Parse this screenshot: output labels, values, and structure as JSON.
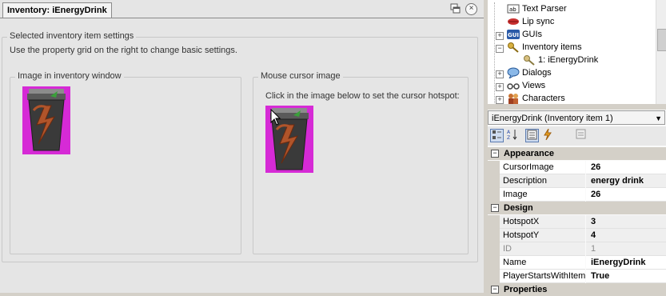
{
  "document": {
    "tab_title": "Inventory: iEnergyDrink",
    "close_glyph": "×"
  },
  "settings": {
    "group_title": "Selected inventory item settings",
    "description": "Use the property grid on the right to change basic settings.",
    "inventory_image_title": "Image in inventory window",
    "cursor_image_title": "Mouse cursor image",
    "cursor_hint": "Click in the image below to set the cursor hotspot:"
  },
  "tree": {
    "items": [
      {
        "label": "Text Parser",
        "icon": "text-parser-icon"
      },
      {
        "label": "Lip sync",
        "icon": "lips-icon"
      },
      {
        "label": "GUIs",
        "icon": "gui-icon"
      },
      {
        "label": "Inventory items",
        "icon": "key-icon"
      },
      {
        "label": "1: iEnergyDrink",
        "icon": "key-icon"
      },
      {
        "label": "Dialogs",
        "icon": "speech-bubble-icon"
      },
      {
        "label": "Views",
        "icon": "glasses-icon"
      },
      {
        "label": "Characters",
        "icon": "characters-icon"
      }
    ]
  },
  "property_grid": {
    "selected_object": "iEnergyDrink (Inventory item 1)",
    "categories": [
      {
        "name": "Appearance",
        "properties": [
          {
            "name": "CursorImage",
            "value": "26"
          },
          {
            "name": "Description",
            "value": "energy drink"
          },
          {
            "name": "Image",
            "value": "26"
          }
        ]
      },
      {
        "name": "Design",
        "properties": [
          {
            "name": "HotspotX",
            "value": "3"
          },
          {
            "name": "HotspotY",
            "value": "4"
          },
          {
            "name": "ID",
            "value": "1"
          },
          {
            "name": "Name",
            "value": "iEnergyDrink"
          },
          {
            "name": "PlayerStartsWithItem",
            "value": "True"
          }
        ]
      },
      {
        "name": "Properties",
        "properties": []
      }
    ]
  },
  "colors": {
    "sprite_background": "#d62ad6",
    "cup_body": "#3a3a3a",
    "lightning": "#b0542a",
    "leaf": "#3aa03a"
  }
}
